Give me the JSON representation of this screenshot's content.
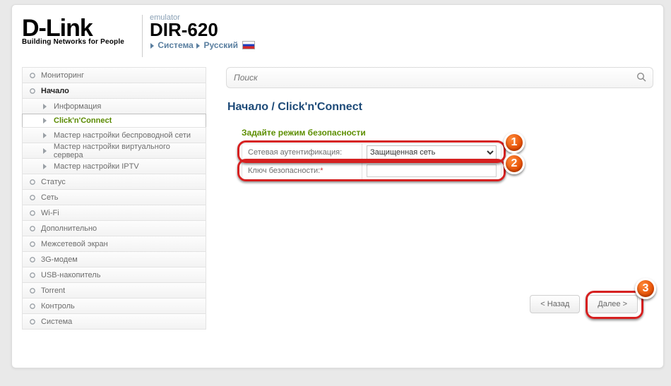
{
  "header": {
    "logo_brand": "D-Link",
    "logo_tag": "Building Networks for People",
    "emulator": "emulator",
    "device": "DIR-620",
    "bc_system": "Система",
    "bc_lang": "Русский"
  },
  "sidebar": {
    "items": [
      {
        "label": "Мониторинг",
        "type": "top"
      },
      {
        "label": "Начало",
        "type": "top",
        "active": true
      },
      {
        "label": "Информация",
        "type": "sub"
      },
      {
        "label": "Click'n'Connect",
        "type": "sub",
        "selected": true
      },
      {
        "label": "Мастер настройки беспроводной сети",
        "type": "sub"
      },
      {
        "label": "Мастер настройки виртуального сервера",
        "type": "sub"
      },
      {
        "label": "Мастер настройки IPTV",
        "type": "sub"
      },
      {
        "label": "Статус",
        "type": "top"
      },
      {
        "label": "Сеть",
        "type": "top"
      },
      {
        "label": "Wi-Fi",
        "type": "top"
      },
      {
        "label": "Дополнительно",
        "type": "top"
      },
      {
        "label": "Межсетевой экран",
        "type": "top"
      },
      {
        "label": "3G-модем",
        "type": "top"
      },
      {
        "label": "USB-накопитель",
        "type": "top"
      },
      {
        "label": "Torrent",
        "type": "top"
      },
      {
        "label": "Контроль",
        "type": "top"
      },
      {
        "label": "Система",
        "type": "top"
      }
    ]
  },
  "search": {
    "placeholder": "Поиск"
  },
  "main": {
    "breadcrumb": "Начало /  Click'n'Connect",
    "section_title": "Задайте режим безопасности",
    "row_auth_label": "Сетевая аутентификация:",
    "row_auth_value": "Защищенная сеть",
    "row_key_label": "Ключ безопасности:",
    "row_key_req": "*",
    "row_key_value": ""
  },
  "buttons": {
    "back": "< Назад",
    "next": "Далее >"
  },
  "annotations": {
    "b1": "1",
    "b2": "2",
    "b3": "3"
  }
}
